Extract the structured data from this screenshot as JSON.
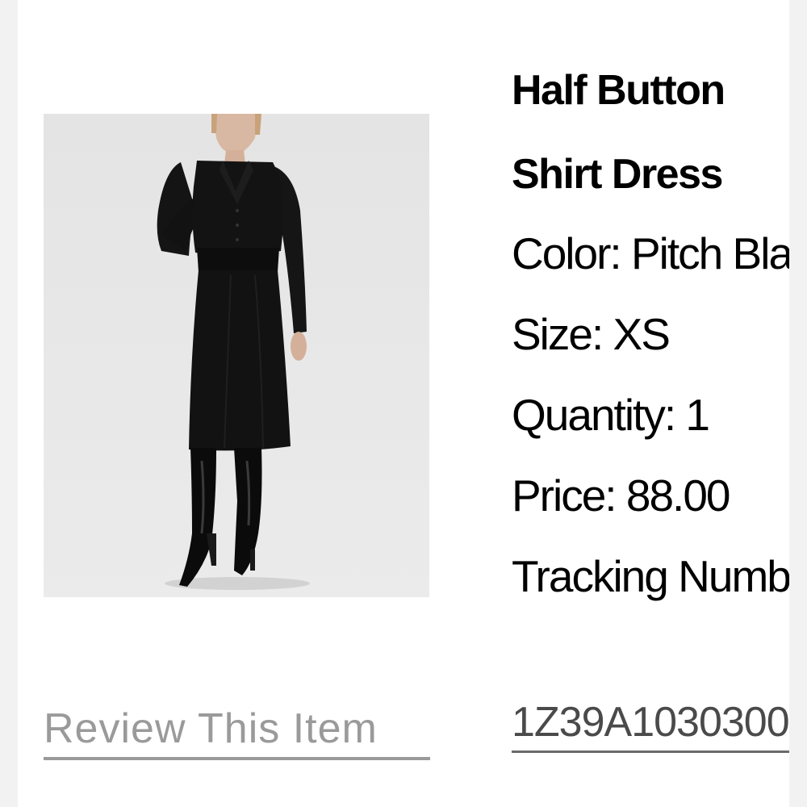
{
  "product": {
    "title_line1": "Half Button",
    "title_line2": "Shirt Dress",
    "image_alt": "Woman wearing a black half button shirt dress with black knee-high boots",
    "color": "Color: Pitch Black",
    "size": "Size: XS",
    "quantity": "Quantity: 1",
    "price": "Price: 88.00",
    "tracking_label": "Tracking Number"
  },
  "links": {
    "review": "Review This Item",
    "tracking_number": "1Z39A1030300"
  },
  "colors": {
    "background": "#f2f2f2",
    "card": "#ffffff",
    "photo_backdrop": "#e3e3e3",
    "dress": "#111111",
    "link_muted": "#9a9a9a"
  }
}
